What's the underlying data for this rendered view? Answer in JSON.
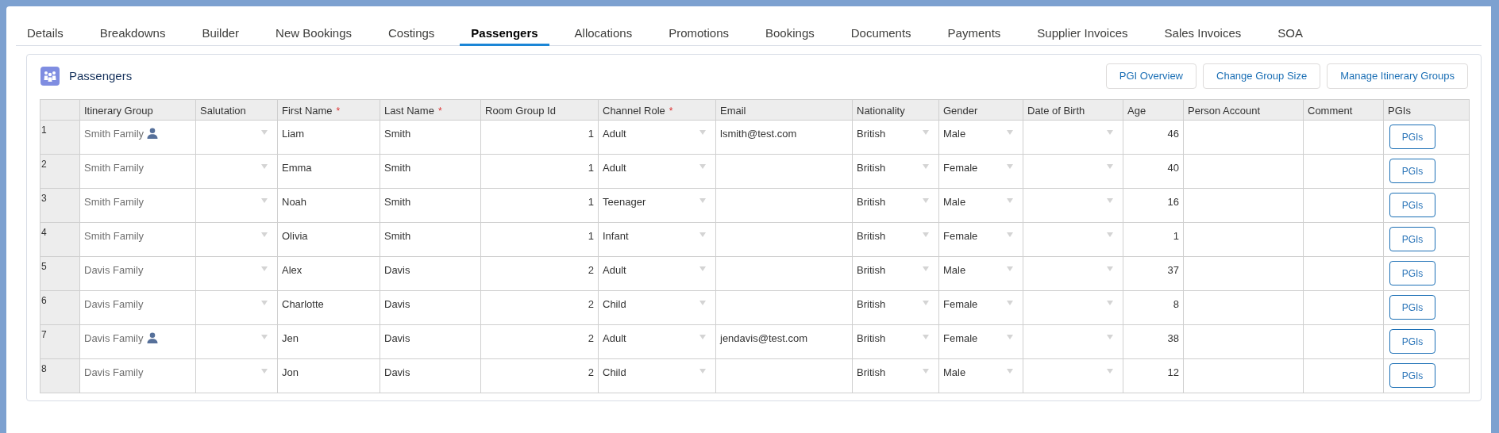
{
  "tabs": [
    {
      "label": "Details",
      "selected": false
    },
    {
      "label": "Breakdowns",
      "selected": false
    },
    {
      "label": "Builder",
      "selected": false
    },
    {
      "label": "New Bookings",
      "selected": false
    },
    {
      "label": "Costings",
      "selected": false
    },
    {
      "label": "Passengers",
      "selected": true
    },
    {
      "label": "Allocations",
      "selected": false
    },
    {
      "label": "Promotions",
      "selected": false
    },
    {
      "label": "Bookings",
      "selected": false
    },
    {
      "label": "Documents",
      "selected": false
    },
    {
      "label": "Payments",
      "selected": false
    },
    {
      "label": "Supplier Invoices",
      "selected": false
    },
    {
      "label": "Sales Invoices",
      "selected": false
    },
    {
      "label": "SOA",
      "selected": false
    }
  ],
  "card": {
    "title": "Passengers",
    "buttons": [
      "PGI Overview",
      "Change Group Size",
      "Manage Itinerary Groups"
    ]
  },
  "table": {
    "columns": [
      {
        "label": "Itinerary Group",
        "kind": "group"
      },
      {
        "label": "Salutation",
        "kind": "select"
      },
      {
        "label": "First Name",
        "required_mark": "*",
        "kind": "text"
      },
      {
        "label": "Last Name",
        "required_mark": "*",
        "kind": "text"
      },
      {
        "label": "Room Group Id",
        "kind": "number"
      },
      {
        "label": "Channel Role",
        "required_mark": "*",
        "kind": "select"
      },
      {
        "label": "Email",
        "kind": "text"
      },
      {
        "label": "Nationality",
        "kind": "select"
      },
      {
        "label": "Gender",
        "kind": "select"
      },
      {
        "label": "Date of Birth",
        "kind": "select"
      },
      {
        "label": "Age",
        "kind": "number"
      },
      {
        "label": "Person Account",
        "kind": "text"
      },
      {
        "label": "Comment",
        "kind": "text"
      },
      {
        "label": "PGIs",
        "kind": "button"
      }
    ],
    "rows": [
      {
        "number": "1",
        "lead": true,
        "cells": [
          "Smith Family",
          "",
          "Liam",
          "Smith",
          "1",
          "Adult",
          "lsmith@test.com",
          "British",
          "Male",
          "",
          "46",
          "",
          "",
          "PGIs"
        ]
      },
      {
        "number": "2",
        "lead": false,
        "cells": [
          "Smith Family",
          "",
          "Emma",
          "Smith",
          "1",
          "Adult",
          "",
          "British",
          "Female",
          "",
          "40",
          "",
          "",
          "PGIs"
        ]
      },
      {
        "number": "3",
        "lead": false,
        "cells": [
          "Smith Family",
          "",
          "Noah",
          "Smith",
          "1",
          "Teenager",
          "",
          "British",
          "Male",
          "",
          "16",
          "",
          "",
          "PGIs"
        ]
      },
      {
        "number": "4",
        "lead": false,
        "cells": [
          "Smith Family",
          "",
          "Olivia",
          "Smith",
          "1",
          "Infant",
          "",
          "British",
          "Female",
          "",
          "1",
          "",
          "",
          "PGIs"
        ]
      },
      {
        "number": "5",
        "lead": false,
        "cells": [
          "Davis Family",
          "",
          "Alex",
          "Davis",
          "2",
          "Adult",
          "",
          "British",
          "Male",
          "",
          "37",
          "",
          "",
          "PGIs"
        ]
      },
      {
        "number": "6",
        "lead": false,
        "cells": [
          "Davis Family",
          "",
          "Charlotte",
          "Davis",
          "2",
          "Child",
          "",
          "British",
          "Female",
          "",
          "8",
          "",
          "",
          "PGIs"
        ]
      },
      {
        "number": "7",
        "lead": true,
        "cells": [
          "Davis Family",
          "",
          "Jen",
          "Davis",
          "2",
          "Adult",
          "jendavis@test.com",
          "British",
          "Female",
          "",
          "38",
          "",
          "",
          "PGIs"
        ]
      },
      {
        "number": "8",
        "lead": false,
        "cells": [
          "Davis Family",
          "",
          "Jon",
          "Davis",
          "2",
          "Child",
          "",
          "British",
          "Male",
          "",
          "12",
          "",
          "",
          "PGIs"
        ]
      }
    ]
  }
}
